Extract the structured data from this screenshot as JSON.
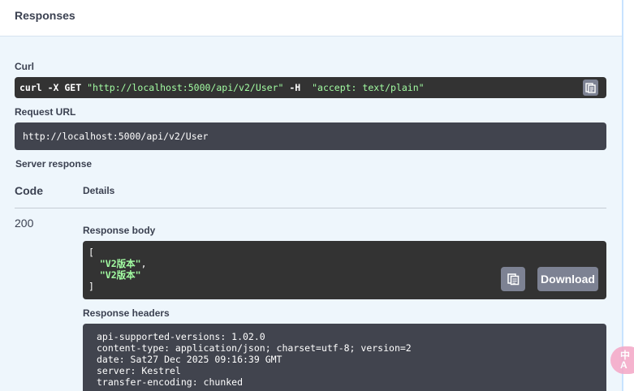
{
  "responses": {
    "title": "Responses"
  },
  "curl": {
    "label": "Curl",
    "prefix": "curl -X GET",
    "url": "\"http://localhost:5000/api/v2/User\"",
    "flag": "-H",
    "header": "\"accept: text/plain\"",
    "copy_icon": "clipboard-icon"
  },
  "request_url": {
    "label": "Request URL",
    "value": "http://localhost:5000/api/v2/User"
  },
  "server_response": {
    "label": "Server response",
    "col_code": "Code",
    "col_details": "Details",
    "status": "200",
    "body_label": "Response body",
    "body_lines": {
      "open": "[",
      "item1": "\"V2版本\"",
      "item1_suffix": ",",
      "item2": "\"V2版本\"",
      "close": "]"
    },
    "copy_icon": "clipboard-icon",
    "download_label": "Download",
    "headers_label": "Response headers",
    "headers": [
      "api-supported-versions: 1.02.0",
      "content-type: application/json; charset=utf-8; version=2",
      "date: Sat27 Dec 2025 09:16:39 GMT",
      "server: Kestrel",
      "transfer-encoding: chunked"
    ]
  },
  "badge": {
    "line1": "中",
    "line2": "A"
  },
  "colors": {
    "code_bg": "#333333",
    "url_bg": "#41444e",
    "string_green": "#a2fca2",
    "button_gray": "#7d8293",
    "section_bg": "#eef6fc"
  }
}
